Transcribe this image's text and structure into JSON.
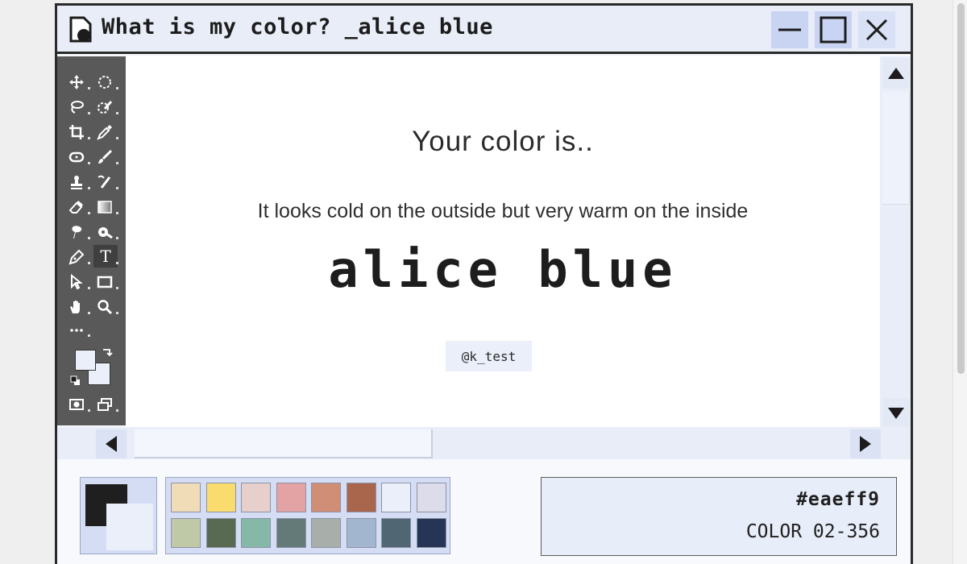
{
  "window": {
    "title": "What is my color? _alice blue",
    "app_icon": "document-icon",
    "controls": [
      "minimize-icon",
      "maximize-icon",
      "close-icon"
    ]
  },
  "toolbox": {
    "tools": [
      "move-icon",
      "ellipse-select-icon",
      "lasso-icon",
      "quick-select-icon",
      "crop-icon",
      "eyedropper-icon",
      "healing-icon",
      "brush-icon",
      "stamp-icon",
      "history-brush-icon",
      "eraser-icon",
      "gradient-icon",
      "smudge-icon",
      "dodge-icon",
      "pen-icon",
      "type-icon",
      "path-select-icon",
      "rectangle-icon",
      "hand-icon",
      "zoom-icon",
      "more-tools-icon",
      "quick-mask-icon",
      "screen-mode-icon"
    ],
    "type_tool_label": "T",
    "foreground_color": "#eaeff9",
    "background_color": "#eaeff9"
  },
  "content": {
    "heading": "Your color is..",
    "description": "It looks cold on the outside but very warm on the inside",
    "color_name": "alice blue",
    "credit": "@k_test"
  },
  "palette": {
    "foreground": "#1f1f1f",
    "background": "#eaeff9",
    "swatches": [
      "#f0dcb6",
      "#fadc6e",
      "#e7cfcb",
      "#e3a2a4",
      "#cf8e75",
      "#a9664d",
      "#eaeff9",
      "#dcdcea",
      "#c0c9a7",
      "#586a52",
      "#86b8a8",
      "#647a78",
      "#a8aeaa",
      "#a3b6cf",
      "#506672",
      "#263556"
    ]
  },
  "info": {
    "hex": "#eaeff9",
    "code": "COLOR 02-356"
  }
}
